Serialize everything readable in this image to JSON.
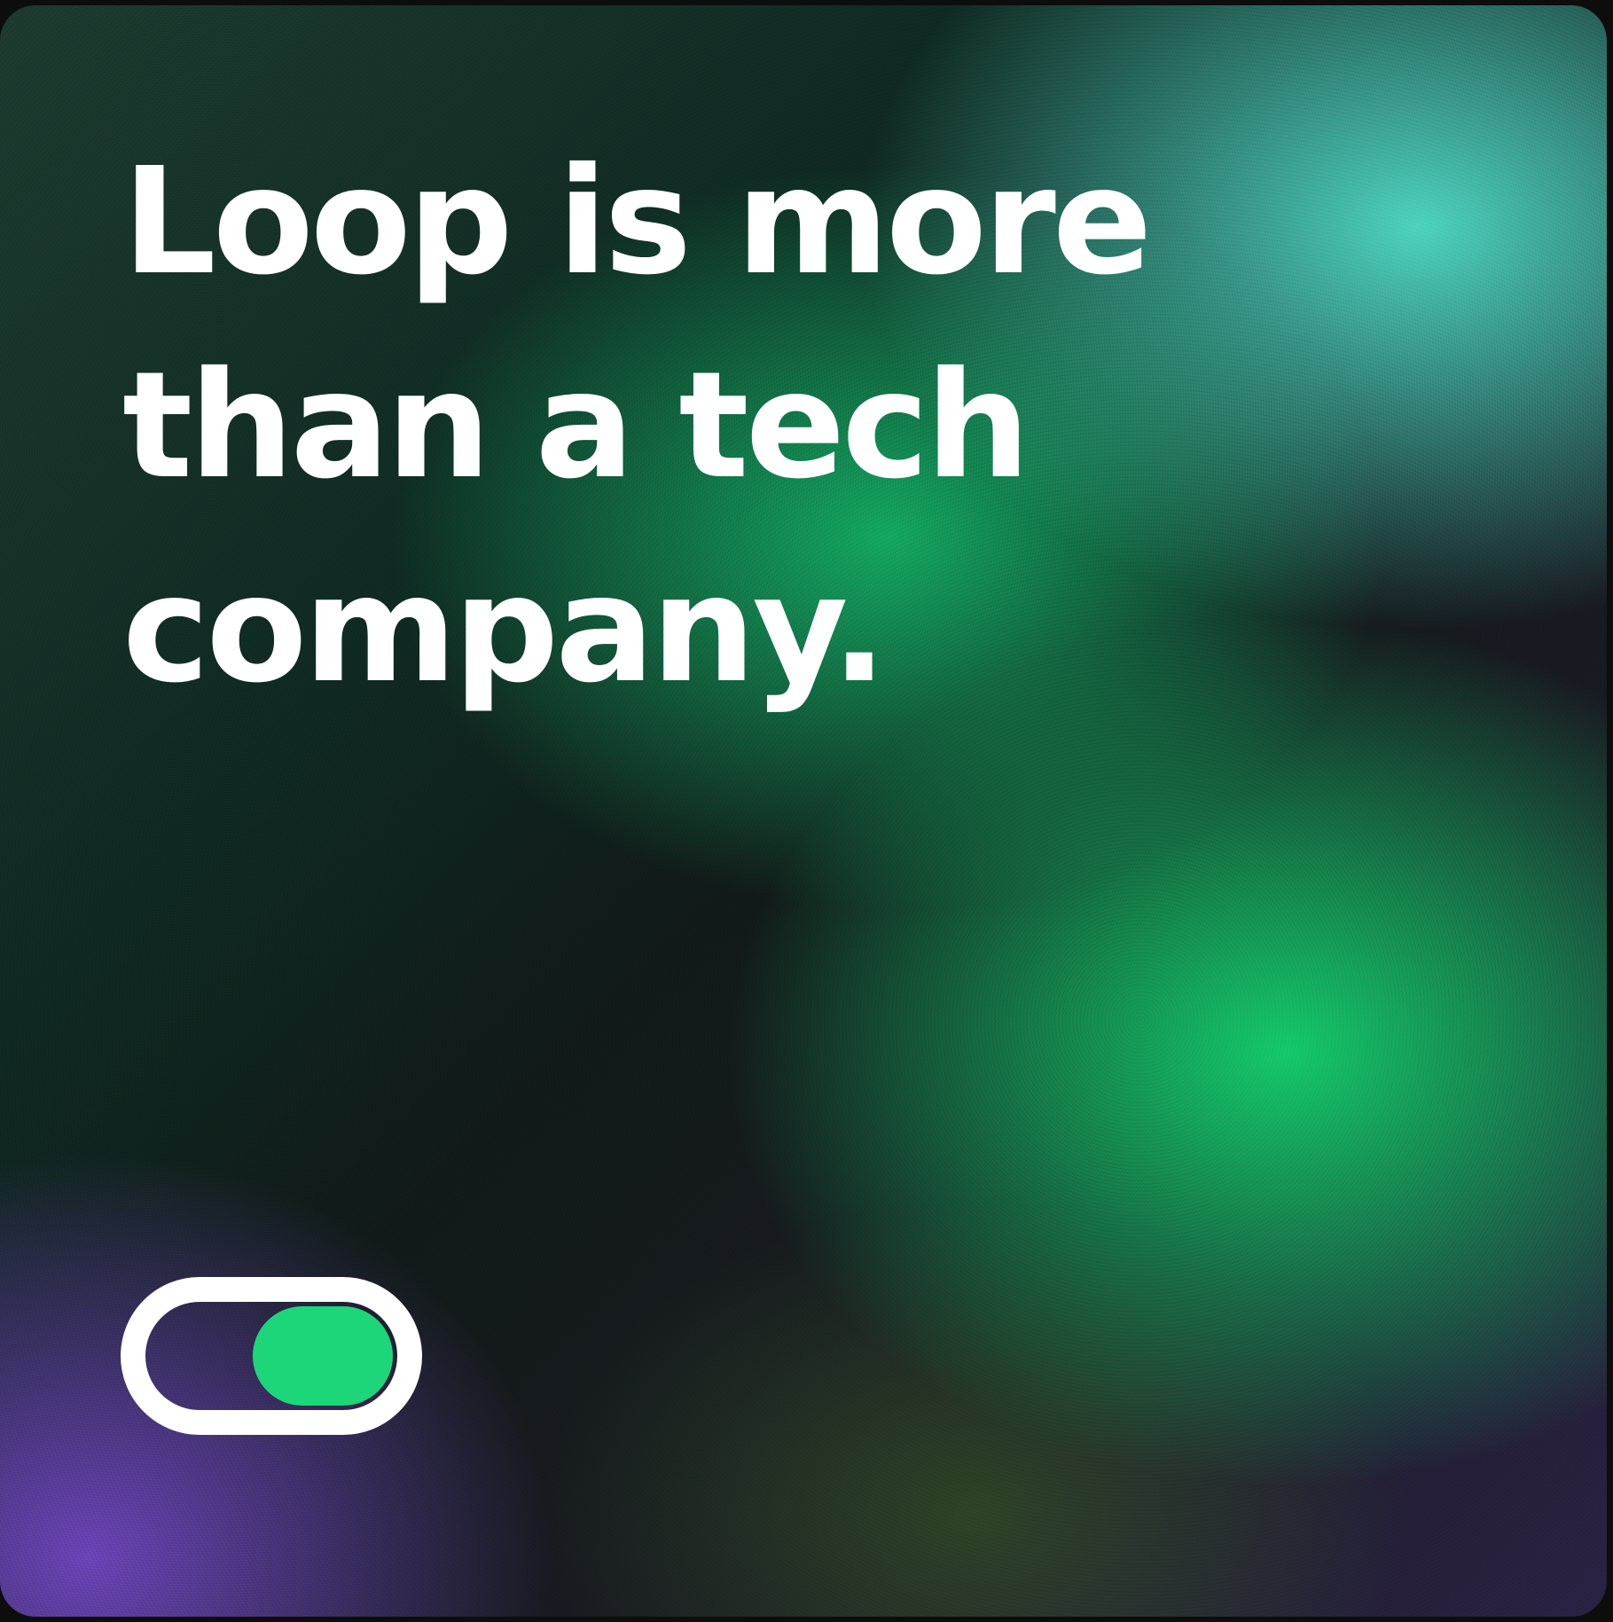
{
  "headline": {
    "line1": "Loop is more",
    "line2": "than a tech",
    "line3": "company."
  },
  "toggle": {
    "state": "on",
    "knob_color": "#1ed67a",
    "track_border_color": "#ffffff"
  },
  "colors": {
    "text": "#ffffff",
    "accent_green": "#1ed67a",
    "accent_teal": "#50dcc8",
    "accent_purple": "#6e46be"
  }
}
